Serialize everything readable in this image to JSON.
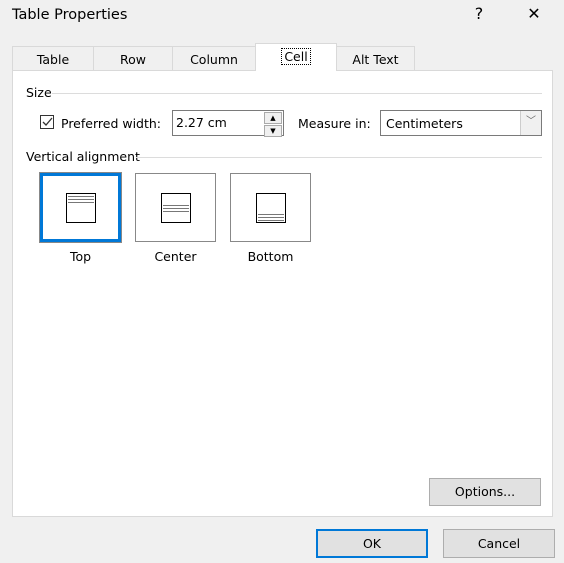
{
  "window": {
    "title": "Table Properties",
    "help_icon": "?",
    "close_icon": "✕"
  },
  "tabs": [
    {
      "label": "Table",
      "ul": 0
    },
    {
      "label": "Row",
      "ul": 0
    },
    {
      "label": "Column",
      "ul": 3
    },
    {
      "label": "Cell",
      "ul": 2,
      "active": true
    },
    {
      "label": "Alt Text",
      "ul": 0
    }
  ],
  "size": {
    "group_label": "Size",
    "preferred_width_label": "Preferred width:",
    "preferred_width_ul": 10,
    "preferred_width_checked": true,
    "width_value": "2.27 cm",
    "measure_label": "Measure in:",
    "measure_ul": 0,
    "measure_value": "Centimeters"
  },
  "valign": {
    "group_label": "Vertical alignment",
    "options": [
      {
        "label": "Top",
        "ul": 2,
        "selected": true
      },
      {
        "label": "Center",
        "ul": 0
      },
      {
        "label": "Bottom",
        "ul": 0
      }
    ]
  },
  "buttons": {
    "options": "Options...",
    "options_ul": 0,
    "ok": "OK",
    "cancel": "Cancel"
  },
  "colors": {
    "accent": "#0078d7"
  }
}
